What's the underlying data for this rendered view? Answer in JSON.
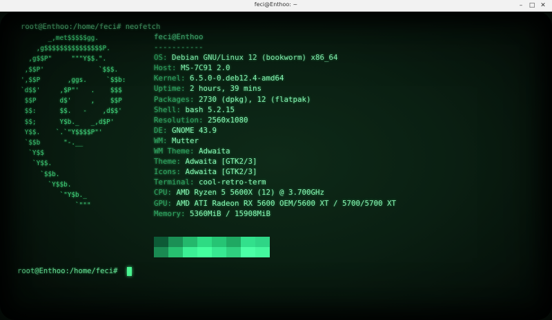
{
  "window": {
    "title": "feci@Enthoo: ~",
    "controls": {
      "minimize": "–",
      "maximize": "□",
      "close": "✕"
    }
  },
  "terminal": {
    "command_line": "root@Enthoo:/home/feci# neofetch",
    "prompt": "root@Enthoo:/home/feci#",
    "ascii_logo": "       _,met$$$$$gg.\n    ,g$$$$$$$$$$$$$$$P.\n  ,g$$P\"     \"\"\"Y$$.\".\n ,$$P'              `$$$.\n',$$P       ,ggs.     `$$b:\n`d$$'     ,$P\"'   .    $$$\n $$P      d$'     ,    $$P\n $$:      $$.   -    ,d$$'\n $$;      Y$b._   _,d$P'\n Y$$.    `.`\"Y$$$$P\"'\n `$$b      \"-.__\n  `Y$$\n   `Y$$.\n     `$$b.\n       `Y$$b.\n          `\"Y$b._\n              `\"\"\"",
    "user_host": "feci@Enthoo",
    "separator": "-----------",
    "info": [
      {
        "key": "OS",
        "value": "Debian GNU/Linux 12 (bookworm) x86_64"
      },
      {
        "key": "Host",
        "value": "MS-7C91 2.0"
      },
      {
        "key": "Kernel",
        "value": "6.5.0-0.deb12.4-amd64"
      },
      {
        "key": "Uptime",
        "value": "2 hours, 39 mins"
      },
      {
        "key": "Packages",
        "value": "2730 (dpkg), 12 (flatpak)"
      },
      {
        "key": "Shell",
        "value": "bash 5.2.15"
      },
      {
        "key": "Resolution",
        "value": "2560x1080"
      },
      {
        "key": "DE",
        "value": "GNOME 43.9"
      },
      {
        "key": "WM",
        "value": "Mutter"
      },
      {
        "key": "WM Theme",
        "value": "Adwaita"
      },
      {
        "key": "Theme",
        "value": "Adwaita [GTK2/3]"
      },
      {
        "key": "Icons",
        "value": "Adwaita [GTK2/3]"
      },
      {
        "key": "Terminal",
        "value": "cool-retro-term"
      },
      {
        "key": "CPU",
        "value": "AMD Ryzen 5 5600X (12) @ 3.700GHz"
      },
      {
        "key": "GPU",
        "value": "AMD ATI Radeon RX 5600 OEM/5600 XT / 5700/5700 XT"
      },
      {
        "key": "Memory",
        "value": "5360MiB / 15908MiB"
      }
    ],
    "color_blocks": {
      "top": [
        "#0d5a36",
        "#1b8f55",
        "#24b86c",
        "#2edb83",
        "#26c474",
        "#1fa862",
        "#32e08c",
        "#2fd586"
      ],
      "bottom": [
        "#1a8a52",
        "#27c070",
        "#3cf095",
        "#44ff9e",
        "#38e891",
        "#2fd07f",
        "#4bffa6",
        "#44f79e"
      ]
    },
    "colors": {
      "phosphor": "#69e69a",
      "key": "#2fa362",
      "value": "#86f2b2",
      "background": "#0a1f12"
    }
  }
}
